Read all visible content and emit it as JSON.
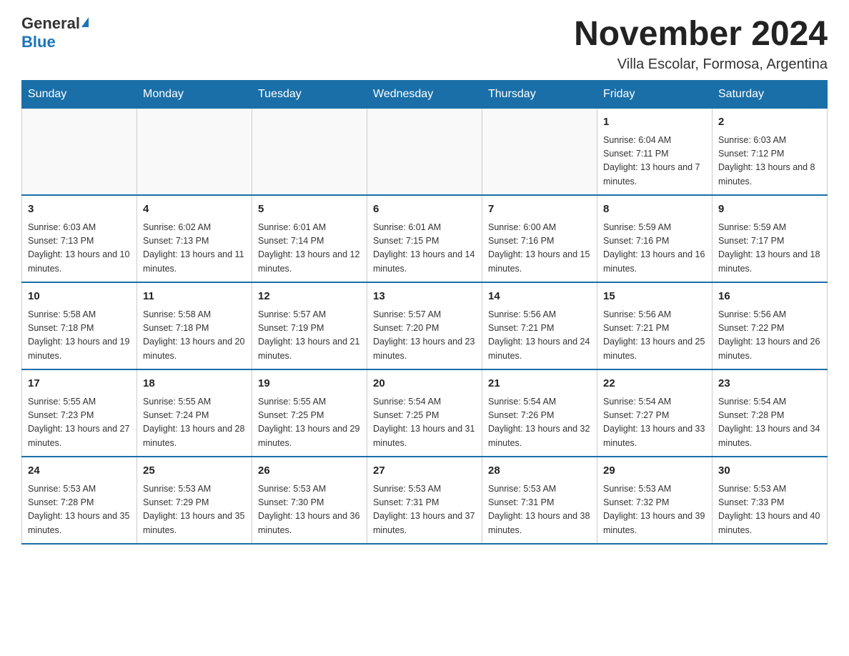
{
  "header": {
    "logo_general": "General",
    "logo_blue": "Blue",
    "title": "November 2024",
    "subtitle": "Villa Escolar, Formosa, Argentina"
  },
  "weekdays": [
    "Sunday",
    "Monday",
    "Tuesday",
    "Wednesday",
    "Thursday",
    "Friday",
    "Saturday"
  ],
  "weeks": [
    [
      {
        "day": "",
        "sunrise": "",
        "sunset": "",
        "daylight": ""
      },
      {
        "day": "",
        "sunrise": "",
        "sunset": "",
        "daylight": ""
      },
      {
        "day": "",
        "sunrise": "",
        "sunset": "",
        "daylight": ""
      },
      {
        "day": "",
        "sunrise": "",
        "sunset": "",
        "daylight": ""
      },
      {
        "day": "",
        "sunrise": "",
        "sunset": "",
        "daylight": ""
      },
      {
        "day": "1",
        "sunrise": "Sunrise: 6:04 AM",
        "sunset": "Sunset: 7:11 PM",
        "daylight": "Daylight: 13 hours and 7 minutes."
      },
      {
        "day": "2",
        "sunrise": "Sunrise: 6:03 AM",
        "sunset": "Sunset: 7:12 PM",
        "daylight": "Daylight: 13 hours and 8 minutes."
      }
    ],
    [
      {
        "day": "3",
        "sunrise": "Sunrise: 6:03 AM",
        "sunset": "Sunset: 7:13 PM",
        "daylight": "Daylight: 13 hours and 10 minutes."
      },
      {
        "day": "4",
        "sunrise": "Sunrise: 6:02 AM",
        "sunset": "Sunset: 7:13 PM",
        "daylight": "Daylight: 13 hours and 11 minutes."
      },
      {
        "day": "5",
        "sunrise": "Sunrise: 6:01 AM",
        "sunset": "Sunset: 7:14 PM",
        "daylight": "Daylight: 13 hours and 12 minutes."
      },
      {
        "day": "6",
        "sunrise": "Sunrise: 6:01 AM",
        "sunset": "Sunset: 7:15 PM",
        "daylight": "Daylight: 13 hours and 14 minutes."
      },
      {
        "day": "7",
        "sunrise": "Sunrise: 6:00 AM",
        "sunset": "Sunset: 7:16 PM",
        "daylight": "Daylight: 13 hours and 15 minutes."
      },
      {
        "day": "8",
        "sunrise": "Sunrise: 5:59 AM",
        "sunset": "Sunset: 7:16 PM",
        "daylight": "Daylight: 13 hours and 16 minutes."
      },
      {
        "day": "9",
        "sunrise": "Sunrise: 5:59 AM",
        "sunset": "Sunset: 7:17 PM",
        "daylight": "Daylight: 13 hours and 18 minutes."
      }
    ],
    [
      {
        "day": "10",
        "sunrise": "Sunrise: 5:58 AM",
        "sunset": "Sunset: 7:18 PM",
        "daylight": "Daylight: 13 hours and 19 minutes."
      },
      {
        "day": "11",
        "sunrise": "Sunrise: 5:58 AM",
        "sunset": "Sunset: 7:18 PM",
        "daylight": "Daylight: 13 hours and 20 minutes."
      },
      {
        "day": "12",
        "sunrise": "Sunrise: 5:57 AM",
        "sunset": "Sunset: 7:19 PM",
        "daylight": "Daylight: 13 hours and 21 minutes."
      },
      {
        "day": "13",
        "sunrise": "Sunrise: 5:57 AM",
        "sunset": "Sunset: 7:20 PM",
        "daylight": "Daylight: 13 hours and 23 minutes."
      },
      {
        "day": "14",
        "sunrise": "Sunrise: 5:56 AM",
        "sunset": "Sunset: 7:21 PM",
        "daylight": "Daylight: 13 hours and 24 minutes."
      },
      {
        "day": "15",
        "sunrise": "Sunrise: 5:56 AM",
        "sunset": "Sunset: 7:21 PM",
        "daylight": "Daylight: 13 hours and 25 minutes."
      },
      {
        "day": "16",
        "sunrise": "Sunrise: 5:56 AM",
        "sunset": "Sunset: 7:22 PM",
        "daylight": "Daylight: 13 hours and 26 minutes."
      }
    ],
    [
      {
        "day": "17",
        "sunrise": "Sunrise: 5:55 AM",
        "sunset": "Sunset: 7:23 PM",
        "daylight": "Daylight: 13 hours and 27 minutes."
      },
      {
        "day": "18",
        "sunrise": "Sunrise: 5:55 AM",
        "sunset": "Sunset: 7:24 PM",
        "daylight": "Daylight: 13 hours and 28 minutes."
      },
      {
        "day": "19",
        "sunrise": "Sunrise: 5:55 AM",
        "sunset": "Sunset: 7:25 PM",
        "daylight": "Daylight: 13 hours and 29 minutes."
      },
      {
        "day": "20",
        "sunrise": "Sunrise: 5:54 AM",
        "sunset": "Sunset: 7:25 PM",
        "daylight": "Daylight: 13 hours and 31 minutes."
      },
      {
        "day": "21",
        "sunrise": "Sunrise: 5:54 AM",
        "sunset": "Sunset: 7:26 PM",
        "daylight": "Daylight: 13 hours and 32 minutes."
      },
      {
        "day": "22",
        "sunrise": "Sunrise: 5:54 AM",
        "sunset": "Sunset: 7:27 PM",
        "daylight": "Daylight: 13 hours and 33 minutes."
      },
      {
        "day": "23",
        "sunrise": "Sunrise: 5:54 AM",
        "sunset": "Sunset: 7:28 PM",
        "daylight": "Daylight: 13 hours and 34 minutes."
      }
    ],
    [
      {
        "day": "24",
        "sunrise": "Sunrise: 5:53 AM",
        "sunset": "Sunset: 7:28 PM",
        "daylight": "Daylight: 13 hours and 35 minutes."
      },
      {
        "day": "25",
        "sunrise": "Sunrise: 5:53 AM",
        "sunset": "Sunset: 7:29 PM",
        "daylight": "Daylight: 13 hours and 35 minutes."
      },
      {
        "day": "26",
        "sunrise": "Sunrise: 5:53 AM",
        "sunset": "Sunset: 7:30 PM",
        "daylight": "Daylight: 13 hours and 36 minutes."
      },
      {
        "day": "27",
        "sunrise": "Sunrise: 5:53 AM",
        "sunset": "Sunset: 7:31 PM",
        "daylight": "Daylight: 13 hours and 37 minutes."
      },
      {
        "day": "28",
        "sunrise": "Sunrise: 5:53 AM",
        "sunset": "Sunset: 7:31 PM",
        "daylight": "Daylight: 13 hours and 38 minutes."
      },
      {
        "day": "29",
        "sunrise": "Sunrise: 5:53 AM",
        "sunset": "Sunset: 7:32 PM",
        "daylight": "Daylight: 13 hours and 39 minutes."
      },
      {
        "day": "30",
        "sunrise": "Sunrise: 5:53 AM",
        "sunset": "Sunset: 7:33 PM",
        "daylight": "Daylight: 13 hours and 40 minutes."
      }
    ]
  ]
}
